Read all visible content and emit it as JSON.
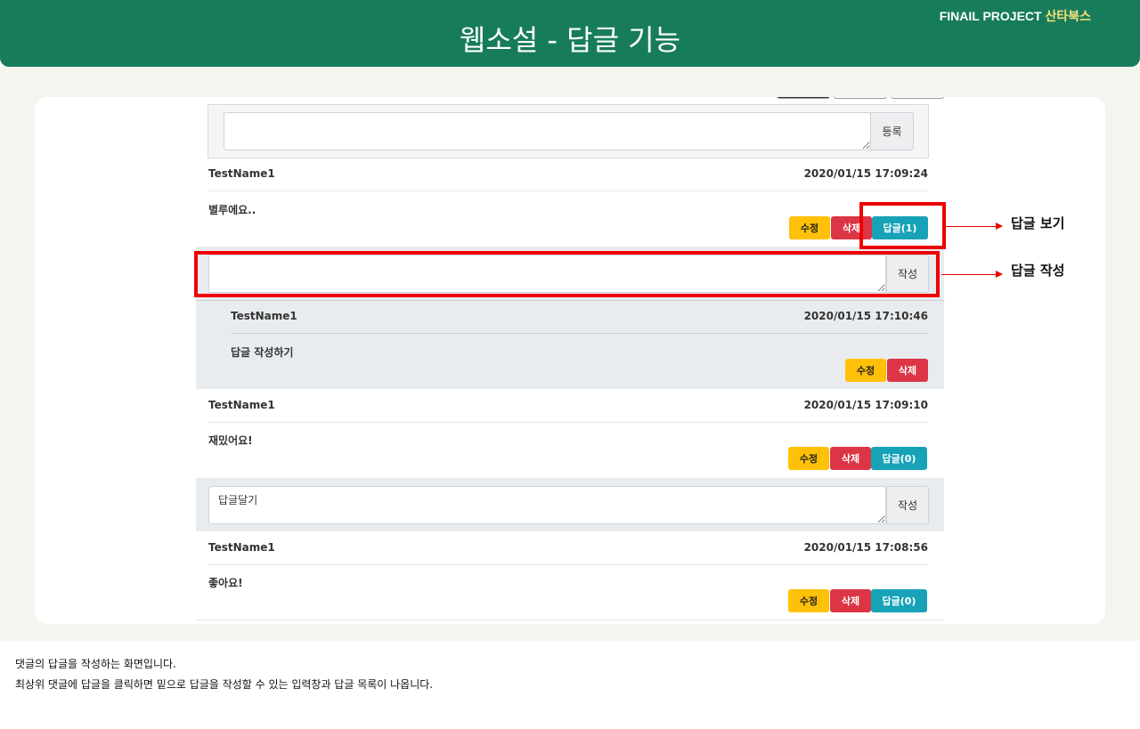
{
  "header": {
    "title": "웹소설 - 답글 기능",
    "brand_main": "FINAIL PROJECT",
    "brand_accent": "산타북스"
  },
  "write_form": {
    "value": "",
    "submit_label": "등록"
  },
  "comments": [
    {
      "author": "TestName1",
      "date": "2020/01/15 17:09:24",
      "text": "별루에요..",
      "edit_label": "수정",
      "delete_label": "삭제",
      "reply_label": "답글(1)",
      "reply_form": {
        "value": "",
        "submit_label": "작성"
      },
      "replies": [
        {
          "author": "TestName1",
          "date": "2020/01/15 17:10:46",
          "text": "답글 작성하기",
          "edit_label": "수정",
          "delete_label": "삭제"
        }
      ]
    },
    {
      "author": "TestName1",
      "date": "2020/01/15 17:09:10",
      "text": "재밌어요!",
      "edit_label": "수정",
      "delete_label": "삭제",
      "reply_label": "답글(0)",
      "reply_form": {
        "value": "답글달기",
        "submit_label": "작성"
      }
    },
    {
      "author": "TestName1",
      "date": "2020/01/15 17:08:56",
      "text": "좋아요!",
      "edit_label": "수정",
      "delete_label": "삭제",
      "reply_label": "답글(0)"
    }
  ],
  "annotations": {
    "view_replies": "답글 보기",
    "write_reply": "답글 작성"
  },
  "caption": {
    "line1": "댓글의 답글을 작성하는 화면입니다.",
    "line2": "최상위 댓글에 답글을 클릭하면 밑으로 답글을 작성할 수 있는 입력창과 답글 목록이 나옵니다."
  },
  "colors": {
    "header_bg": "#177c5b",
    "brand_accent": "#f5e27a",
    "edit_btn": "#ffc107",
    "delete_btn": "#dc3545",
    "reply_btn": "#17a2b8",
    "highlight": "#ee0000"
  }
}
